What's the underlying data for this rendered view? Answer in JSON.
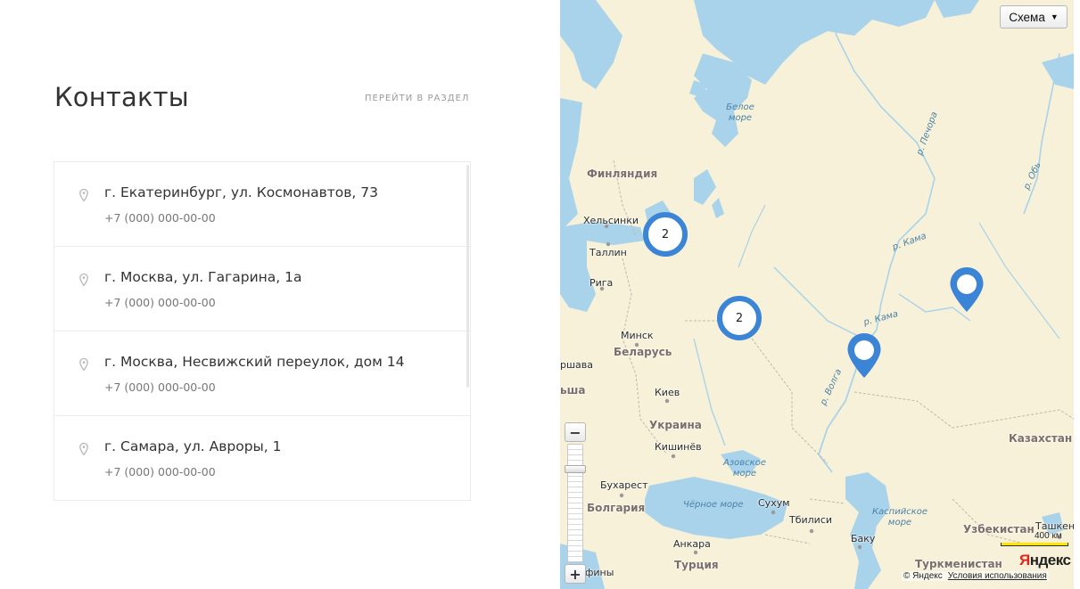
{
  "section": {
    "title": "Контакты",
    "goto_label": "ПЕРЕЙТИ В РАЗДЕЛ"
  },
  "contacts": [
    {
      "address": "г. Екатеринбург, ул. Космонавтов, 73",
      "phone": "+7 (000) 000-00-00"
    },
    {
      "address": "г. Москва, ул. Гагарина, 1а",
      "phone": "+7 (000) 000-00-00"
    },
    {
      "address": "г. Москва, Несвижский переулок, дом 14",
      "phone": "+7 (000) 000-00-00"
    },
    {
      "address": "г. Самара, ул. Авроры, 1",
      "phone": "+7 (000) 000-00-00"
    }
  ],
  "map": {
    "layer_button": "Схема",
    "scale_label": "400 км",
    "logo_ya": "Я",
    "logo_rest": "ндекс",
    "copyright": "© Яндекс",
    "terms": "Условия использования",
    "clusters": [
      {
        "count": "2"
      },
      {
        "count": "2"
      }
    ],
    "labels": {
      "finland": "Финляндия",
      "helsinki": "Хельсинки",
      "tallinn": "Таллин",
      "riga": "Рига",
      "minsk": "Минск",
      "belarus": "Беларусь",
      "warsaw": "ршава",
      "poland": "ьша",
      "kiev": "Киев",
      "ukraine": "Украина",
      "chisinau": "Кишинёв",
      "bucharest": "Бухарест",
      "bulgaria": "Болгария",
      "sofia": "фины",
      "ankara": "Анкара",
      "turkey": "Турция",
      "sukhum": "Сухум",
      "tbilisi": "Тбилиси",
      "baku": "Баку",
      "kazakhstan": "Казахстан",
      "uzbekistan": "Узбекистан",
      "turkmenistan": "Туркменистан",
      "tashkent": "Ташкент",
      "white_sea": "Белое море",
      "black_sea": "Чёрное море",
      "azov_sea": "Азовское море",
      "caspian_sea": "Каспийское море",
      "pechora": "р. Печора",
      "ob": "р. Обь",
      "kama1": "р. Кама",
      "kama2": "р. Кама",
      "volga": "р. Волга"
    }
  },
  "colors": {
    "marker": "#3b84d6",
    "land": "#f6f1d8",
    "water": "#a9d3ea"
  }
}
